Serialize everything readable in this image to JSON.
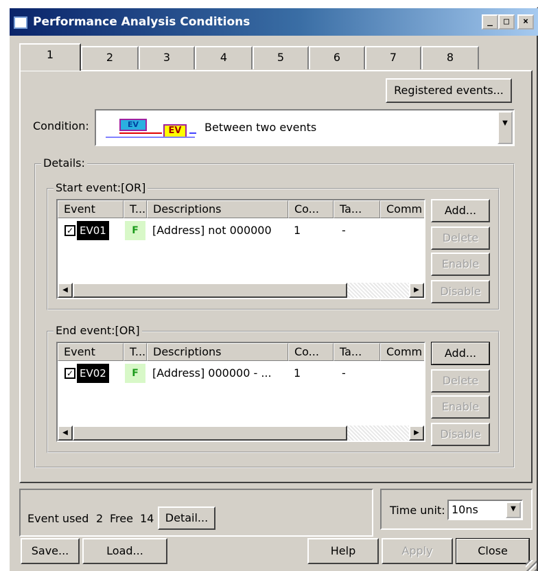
{
  "window": {
    "title": "Performance Analysis Conditions"
  },
  "tabs": [
    "1",
    "2",
    "3",
    "4",
    "5",
    "6",
    "7",
    "8"
  ],
  "registered_events_label": "Registered events...",
  "condition": {
    "label": "Condition:",
    "value": "Between two events",
    "icon_text": "EV"
  },
  "details_label": "Details:",
  "columns": [
    "Event",
    "T...",
    "Descriptions",
    "Co...",
    "Ta...",
    "Comm"
  ],
  "start_event": {
    "label": "Start event:[OR]",
    "rows": [
      {
        "checked": true,
        "event": "EV01",
        "type": "F",
        "description": "[Address] not 000000",
        "count": "1",
        "target": "-",
        "comment": ""
      }
    ]
  },
  "end_event": {
    "label": "End event:[OR]",
    "rows": [
      {
        "checked": true,
        "event": "EV02",
        "type": "F",
        "description": "[Address] 000000 - ...",
        "count": "1",
        "target": "-",
        "comment": ""
      }
    ]
  },
  "side_buttons": {
    "add": "Add...",
    "delete": "Delete",
    "enable": "Enable",
    "disable": "Disable"
  },
  "status": {
    "event_used_label": "Event used",
    "used": "2",
    "free_label": "Free",
    "free": "14",
    "detail_label": "Detail..."
  },
  "time_unit": {
    "label": "Time unit:",
    "value": "10ns"
  },
  "buttons": {
    "save": "Save...",
    "load": "Load...",
    "help": "Help",
    "apply": "Apply",
    "close": "Close"
  },
  "colors": {
    "title_start": "#0a246a",
    "title_end": "#a6caf0",
    "face": "#d4d0c8",
    "type_cell": "#d8f8c8"
  }
}
